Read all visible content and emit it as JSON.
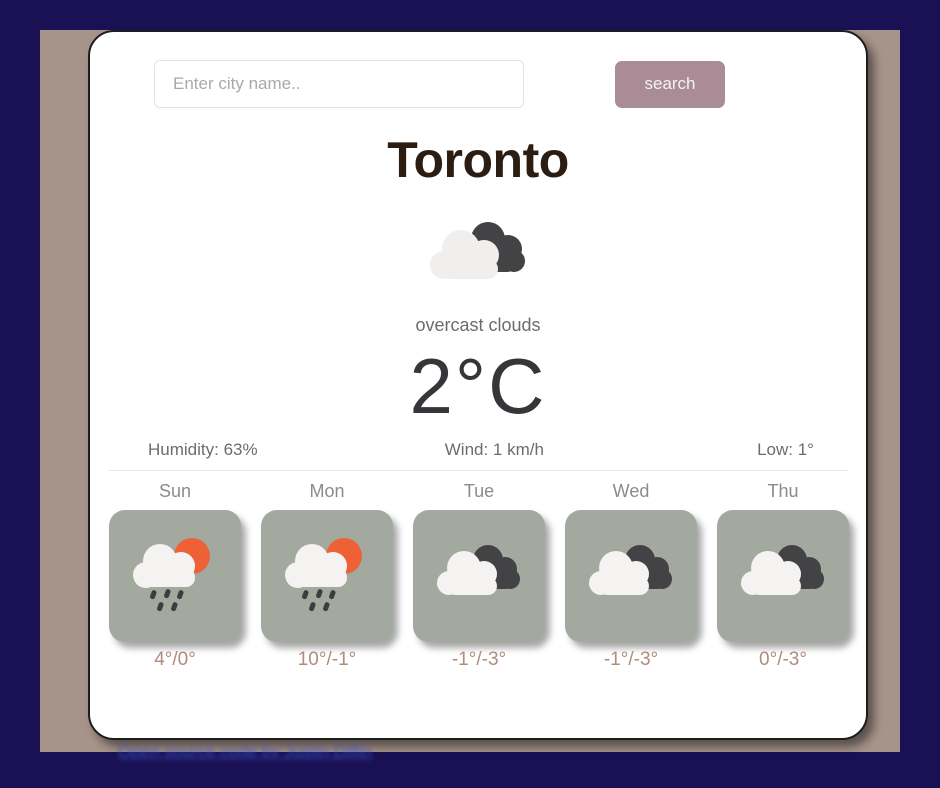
{
  "theme": {
    "outer_background": "#1a1155",
    "page_background": "#a6938a",
    "card_background": "#ffffff",
    "search_button_color": "#a98c96",
    "forecast_tile_color": "#a3a99f",
    "forecast_temp_color": "#b08b7e",
    "cloud_light_color": "#f0efed",
    "cloud_dark_color": "#434345",
    "sun_color": "#ee6036",
    "rain_color": "#3d3d40"
  },
  "search": {
    "placeholder": "Enter city name..",
    "value": "",
    "button_label": "search",
    "icon": "search-icon"
  },
  "current": {
    "city": "Toronto",
    "icon": "overcast-clouds-icon",
    "condition": "overcast clouds",
    "temperature": "2°C",
    "humidity": "Humidity: 63%",
    "wind": "Wind: 1 km/h",
    "low": "Low: 1°"
  },
  "forecast": [
    {
      "day": "Sun",
      "icon": "rain-with-sun-icon",
      "temps": "4°/0°"
    },
    {
      "day": "Mon",
      "icon": "rain-with-sun-icon",
      "temps": "10°/-1°"
    },
    {
      "day": "Tue",
      "icon": "overcast-clouds-icon",
      "temps": "-1°/-3°"
    },
    {
      "day": "Wed",
      "icon": "overcast-clouds-icon",
      "temps": "-1°/-3°"
    },
    {
      "day": "Thu",
      "icon": "overcast-clouds-icon",
      "temps": "0°/-3°"
    }
  ],
  "footer": {
    "link_text": "Open source code by Justin Diffin"
  }
}
